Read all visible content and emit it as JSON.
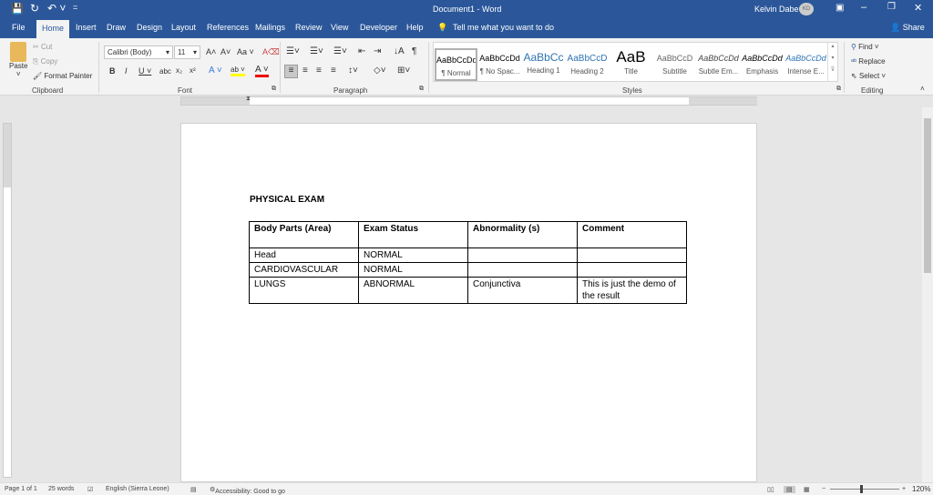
{
  "titlebar": {
    "title": "Document1  -  Word",
    "user": "Kelvin Dabe",
    "initials": "KD"
  },
  "tabs": [
    "File",
    "Home",
    "Insert",
    "Draw",
    "Design",
    "Layout",
    "References",
    "Mailings",
    "Review",
    "View",
    "Developer",
    "Help"
  ],
  "tell_me": "Tell me what you want to do",
  "share": "Share",
  "clipboard": {
    "paste": "Paste",
    "cut": "Cut",
    "copy": "Copy",
    "format_painter": "Format Painter",
    "label": "Clipboard"
  },
  "font": {
    "name": "Calibri (Body)",
    "size": "11",
    "label": "Font"
  },
  "paragraph": {
    "label": "Paragraph"
  },
  "styles": {
    "label": "Styles",
    "items": [
      {
        "sample": "AaBbCcDd",
        "name": "¶ Normal"
      },
      {
        "sample": "AaBbCcDd",
        "name": "¶ No Spac..."
      },
      {
        "sample": "AaBbCc",
        "name": "Heading 1"
      },
      {
        "sample": "AaBbCcD",
        "name": "Heading 2"
      },
      {
        "sample": "AaB",
        "name": "Title"
      },
      {
        "sample": "AaBbCcD",
        "name": "Subtitle"
      },
      {
        "sample": "AaBbCcDd",
        "name": "Subtle Em..."
      },
      {
        "sample": "AaBbCcDd",
        "name": "Emphasis"
      },
      {
        "sample": "AaBbCcDd",
        "name": "Intense E..."
      }
    ]
  },
  "editing": {
    "find": "Find",
    "replace": "Replace",
    "select": "Select",
    "label": "Editing"
  },
  "document": {
    "heading": "PHYSICAL EXAM",
    "table": {
      "headers": [
        "Body Parts (Area)",
        "Exam Status",
        "Abnormality (s)",
        "Comment"
      ],
      "rows": [
        [
          "Head",
          "NORMAL",
          "",
          ""
        ],
        [
          "CARDIOVASCULAR",
          "NORMAL",
          "",
          ""
        ],
        [
          "LUNGS",
          "ABNORMAL",
          "Conjunctiva",
          "This is just the demo of the result"
        ]
      ]
    }
  },
  "status": {
    "page": "Page 1 of 1",
    "words": "25 words",
    "language": "English (Sierra Leone)",
    "accessibility": "Accessibility: Good to go",
    "zoom": "120%"
  },
  "colors": {
    "brand": "#2b579a"
  }
}
